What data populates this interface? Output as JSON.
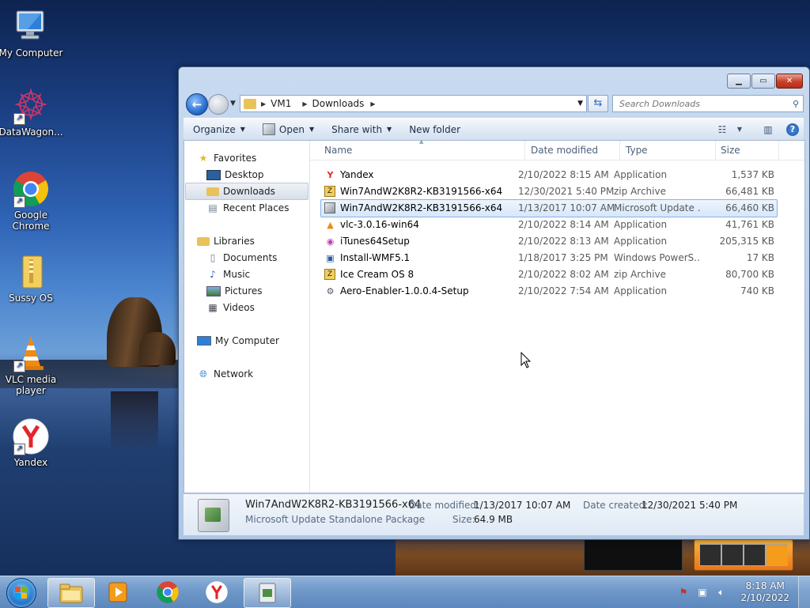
{
  "desktop": {
    "icons": [
      {
        "label": "My Computer"
      },
      {
        "label": "DataWagon..."
      },
      {
        "label": "Google Chrome"
      },
      {
        "label": "Sussy OS"
      },
      {
        "label": "VLC media player"
      },
      {
        "label": "Yandex"
      }
    ]
  },
  "window": {
    "breadcrumb": [
      "VM1",
      "Downloads"
    ],
    "search_placeholder": "Search Downloads",
    "toolbar": {
      "organize": "Organize",
      "open": "Open",
      "share_with": "Share with",
      "new_folder": "New folder"
    },
    "nav": {
      "favorites": "Favorites",
      "desktop": "Desktop",
      "downloads": "Downloads",
      "recent_places": "Recent Places",
      "libraries": "Libraries",
      "documents": "Documents",
      "music": "Music",
      "pictures": "Pictures",
      "videos": "Videos",
      "my_computer": "My Computer",
      "network": "Network"
    },
    "columns": {
      "name": "Name",
      "date_modified": "Date modified",
      "type": "Type",
      "size": "Size"
    },
    "files": [
      {
        "name": "Yandex",
        "date": "2/10/2022 8:15 AM",
        "type": "Application",
        "size": "1,537 KB",
        "icon": "yandex-icon"
      },
      {
        "name": "Win7AndW2K8R2-KB3191566-x64",
        "date": "12/30/2021 5:40 PM",
        "type": "zip Archive",
        "size": "66,481 KB",
        "icon": "zip-archive-icon"
      },
      {
        "name": "Win7AndW2K8R2-KB3191566-x64",
        "date": "1/13/2017 10:07 AM",
        "type": "Microsoft Update ...",
        "size": "66,460 KB",
        "icon": "msu-package-icon"
      },
      {
        "name": "vlc-3.0.16-win64",
        "date": "2/10/2022 8:14 AM",
        "type": "Application",
        "size": "41,761 KB",
        "icon": "vlc-icon"
      },
      {
        "name": "iTunes64Setup",
        "date": "2/10/2022 8:13 AM",
        "type": "Application",
        "size": "205,315 KB",
        "icon": "itunes-icon"
      },
      {
        "name": "Install-WMF5.1",
        "date": "1/18/2017 3:25 PM",
        "type": "Windows PowerS...",
        "size": "17 KB",
        "icon": "powershell-script-icon"
      },
      {
        "name": "Ice Cream OS 8",
        "date": "2/10/2022 8:02 AM",
        "type": "zip Archive",
        "size": "80,700 KB",
        "icon": "zip-archive-icon"
      },
      {
        "name": "Aero-Enabler-1.0.0.4-Setup",
        "date": "2/10/2022 7:54 AM",
        "type": "Application",
        "size": "740 KB",
        "icon": "setup-gear-icon"
      }
    ],
    "details": {
      "name": "Win7AndW2K8R2-KB3191566-x64",
      "type": "Microsoft Update Standalone Package",
      "date_modified_label": "Date modified:",
      "date_modified": "1/13/2017 10:07 AM",
      "date_created_label": "Date created:",
      "date_created": "12/30/2021 5:40 PM",
      "size_label": "Size:",
      "size": "64.9 MB"
    }
  },
  "taskbar": {
    "time": "8:18 AM",
    "date": "2/10/2022"
  }
}
